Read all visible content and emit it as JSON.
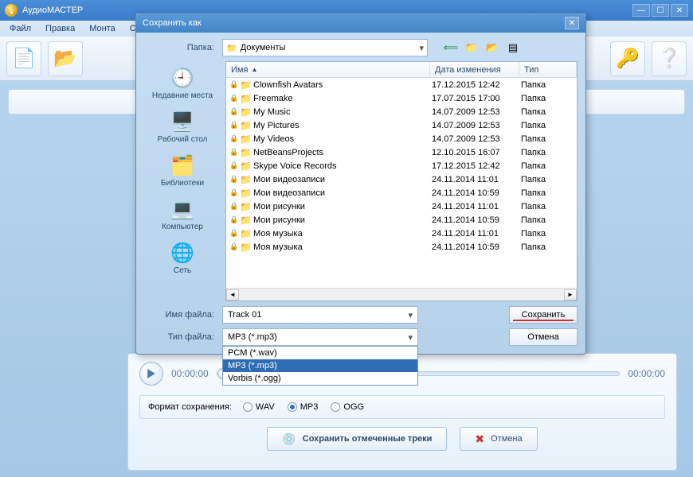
{
  "main": {
    "title": "АудиоМАСТЕР",
    "menu": [
      "Файл",
      "Правка",
      "Монта",
      "CD"
    ],
    "player": {
      "t1": "00:00:00",
      "t2": "00:00:00",
      "format_label": "Формат сохранения:",
      "formats": [
        "WAV",
        "MP3",
        "OGG"
      ],
      "selected_format": "MP3",
      "save_btn": "Сохранить отмеченные треки",
      "cancel_btn": "Отмена"
    }
  },
  "dialog": {
    "title": "Сохранить как",
    "folder_label": "Папка:",
    "folder_value": "Документы",
    "places": [
      {
        "label": "Недавние места",
        "icon": "🕘"
      },
      {
        "label": "Рабочий стол",
        "icon": "🖥️"
      },
      {
        "label": "Библиотеки",
        "icon": "🗂️"
      },
      {
        "label": "Компьютер",
        "icon": "💻"
      },
      {
        "label": "Сеть",
        "icon": "🌐"
      }
    ],
    "cols": {
      "name": "Имя",
      "date": "Дата изменения",
      "type": "Тип"
    },
    "files": [
      {
        "lock": true,
        "name": "Clownfish Avatars",
        "date": "17.12.2015 12:42",
        "type": "Папка"
      },
      {
        "lock": true,
        "name": "Freemake",
        "date": "17.07.2015 17:00",
        "type": "Папка"
      },
      {
        "lock": true,
        "name": "My Music",
        "date": "14.07.2009 12:53",
        "type": "Папка"
      },
      {
        "lock": true,
        "name": "My Pictures",
        "date": "14.07.2009 12:53",
        "type": "Папка"
      },
      {
        "lock": true,
        "name": "My Videos",
        "date": "14.07.2009 12:53",
        "type": "Папка"
      },
      {
        "lock": true,
        "name": "NetBeansProjects",
        "date": "12.10.2015 16:07",
        "type": "Папка"
      },
      {
        "lock": true,
        "name": "Skype Voice Records",
        "date": "17.12.2015 12:42",
        "type": "Папка"
      },
      {
        "lock": true,
        "name": "Мои видеозаписи",
        "date": "24.11.2014 11:01",
        "type": "Папка"
      },
      {
        "lock": true,
        "name": "Мои видеозаписи",
        "date": "24.11.2014 10:59",
        "type": "Папка"
      },
      {
        "lock": true,
        "name": "Мои рисунки",
        "date": "24.11.2014 11:01",
        "type": "Папка"
      },
      {
        "lock": true,
        "name": "Мои рисунки",
        "date": "24.11.2014 10:59",
        "type": "Папка"
      },
      {
        "lock": true,
        "name": "Моя музыка",
        "date": "24.11.2014 11:01",
        "type": "Папка"
      },
      {
        "lock": true,
        "name": "Моя музыка",
        "date": "24.11.2014 10:59",
        "type": "Папка"
      }
    ],
    "filename_label": "Имя файла:",
    "filename_value": "Track 01",
    "filetype_label": "Тип файла:",
    "filetype_value": "MP3 (*.mp3)",
    "filetype_options": [
      "PCM (*.wav)",
      "MP3 (*.mp3)",
      "Vorbis (*.ogg)"
    ],
    "filetype_selected_index": 1,
    "save": "Сохранить",
    "cancel": "Отмена"
  }
}
